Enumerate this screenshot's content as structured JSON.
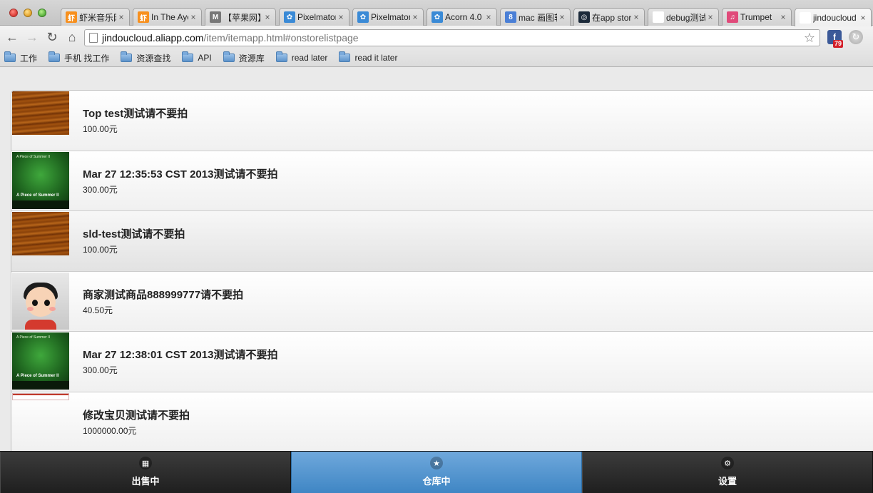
{
  "tabs": [
    {
      "title": "虾米音乐网",
      "favicon": "虾",
      "favicon_color": "#f7901e",
      "active": false
    },
    {
      "title": "In The Ayer",
      "favicon": "虾",
      "favicon_color": "#f7901e",
      "active": false
    },
    {
      "title": "【苹果网】",
      "favicon": "M",
      "favicon_color": "#777777",
      "active": false
    },
    {
      "title": "Pixelmator",
      "favicon": "✿",
      "favicon_color": "#3a8ad6",
      "active": false
    },
    {
      "title": "Pixelmator",
      "favicon": "✿",
      "favicon_color": "#3a8ad6",
      "active": false
    },
    {
      "title": "Acorn 4.0",
      "favicon": "✿",
      "favicon_color": "#3a8ad6",
      "active": false
    },
    {
      "title": "mac 画图软",
      "favicon": "8",
      "favicon_color": "#4a7fd6",
      "active": false
    },
    {
      "title": "在app stor",
      "favicon": "◎",
      "favicon_color": "#1c2a3a",
      "active": false
    },
    {
      "title": "debug测试",
      "favicon": "",
      "favicon_color": "#ffffff",
      "active": false
    },
    {
      "title": "Trumpet",
      "favicon": "♫",
      "favicon_color": "#e04a7a",
      "active": false
    },
    {
      "title": "jindoucloud",
      "favicon": "",
      "favicon_color": "#ffffff",
      "active": true
    }
  ],
  "toolbar": {
    "url_host": "jindoucloud.aliapp.com",
    "url_path": "/item/itemapp.html#onstorelistpage",
    "ext_badge": "79"
  },
  "bookmarks": [
    "工作",
    "手机 找工作",
    "资源查找",
    "API",
    "资源库",
    "read later",
    "read it later"
  ],
  "items": [
    {
      "title": "Top test测试请不要拍",
      "price": "100.00元",
      "thumb": "wood"
    },
    {
      "title": "Mar 27 12:35:53 CST 2013测试请不要拍",
      "price": "300.00元",
      "thumb": "game"
    },
    {
      "title": "sld-test测试请不要拍",
      "price": "100.00元",
      "thumb": "wood"
    },
    {
      "title": "商家测试商品888999777请不要拍",
      "price": "40.50元",
      "thumb": "avatar"
    },
    {
      "title": "Mar 27 12:38:01 CST 2013测试请不要拍",
      "price": "300.00元",
      "thumb": "game"
    },
    {
      "title": "修改宝贝测试请不要拍",
      "price": "1000000.00元",
      "thumb": "shot"
    }
  ],
  "thumb_text": {
    "game_title": "A Piece of Summer II",
    "game_top": "A Piece of Summer II"
  },
  "navbar": [
    {
      "label": "出售中",
      "icon": "grid-icon",
      "active": false
    },
    {
      "label": "仓库中",
      "icon": "star-icon",
      "active": true
    },
    {
      "label": "设置",
      "icon": "gear-icon",
      "active": false
    }
  ]
}
